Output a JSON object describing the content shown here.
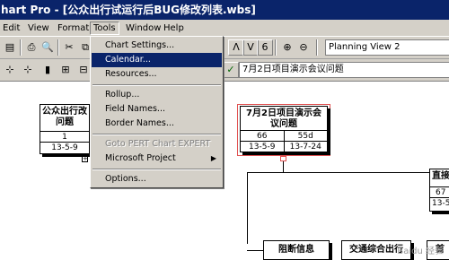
{
  "window": {
    "title": "hart Pro - [公众出行试运行后BUG修改列表.wbs]"
  },
  "menubar": {
    "items": [
      {
        "label": "Edit"
      },
      {
        "label": "View"
      },
      {
        "label": "Format"
      },
      {
        "label": "Tools"
      },
      {
        "label": "Window"
      },
      {
        "label": "Help"
      }
    ]
  },
  "toolbar": {
    "plan_view": "Planning View 2",
    "task_name_edit": "7月2日项目演示会议问题",
    "glyphs": {
      "save": "▤",
      "print": "⎙",
      "preview": "🔍",
      "cut": "✂",
      "copy": "⧉",
      "dec": "ᐱ",
      "inc": "ᐯ",
      "bold": "6",
      "zoom_in": "⊕",
      "zoom_out": "⊖",
      "check": "✓"
    }
  },
  "tools_menu": {
    "items": [
      {
        "label": "Chart Settings...",
        "state": "normal"
      },
      {
        "label": "Calendar...",
        "state": "selected"
      },
      {
        "label": "Resources...",
        "state": "normal"
      },
      {
        "label": "Rollup...",
        "state": "normal"
      },
      {
        "label": "Field Names...",
        "state": "normal"
      },
      {
        "label": "Border Names...",
        "state": "normal"
      },
      {
        "label": "Goto PERT Chart EXPERT",
        "state": "disabled"
      },
      {
        "label": "Microsoft Project",
        "state": "submenu"
      },
      {
        "label": "Options...",
        "state": "normal"
      }
    ]
  },
  "pert": {
    "left_box": {
      "title": "公众出行改问题",
      "row1": [
        "1",
        ""
      ],
      "row2": [
        "13-5-9",
        ""
      ]
    },
    "center_box": {
      "title": "7月2日项目演示会议问题",
      "row1": [
        "66",
        "55d"
      ],
      "row2": [
        "13-5-9",
        "13-7-24"
      ]
    },
    "right_box": {
      "title": "直接",
      "row1": [
        "67"
      ],
      "row2": [
        "13-5"
      ]
    },
    "bottom_boxes": [
      "阻断信息",
      "交通综合出行",
      "首"
    ]
  },
  "watermark": "Baidu 经验"
}
